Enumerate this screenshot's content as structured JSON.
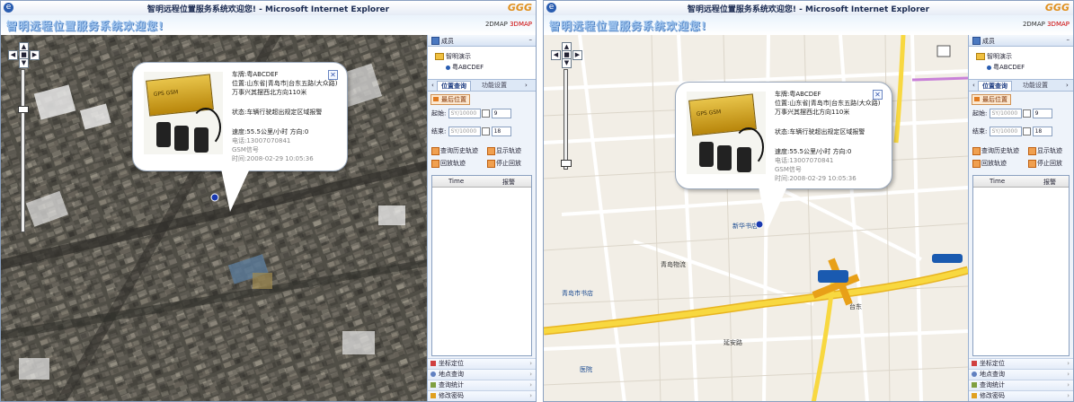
{
  "window": {
    "title": "智明远程位置服务系统欢迎您! - Microsoft Internet Explorer",
    "logo_text": "GGG"
  },
  "header": {
    "welcome": "智明远程位置服务系统欢迎您!",
    "map_2d": "2DMAP",
    "map_3d": "3DMAP"
  },
  "panel": {
    "section_title": "成员",
    "tree_group": "智明演示",
    "tree_vehicle": "粤ABCDEF",
    "tab_position_query": "位置查询",
    "tab_function_settings": "功能设置",
    "last_position": "最后位置",
    "start_label": "起始:",
    "end_label": "结束:",
    "date_placeholder": "SY/10000",
    "start_hour": "9",
    "end_hour": "18",
    "btn_query_history": "查询历史轨迹",
    "btn_show_track": "显示轨迹",
    "btn_replay_track": "回放轨迹",
    "btn_stop_replay": "停止回放",
    "col_time": "Time",
    "col_alarm": "报警",
    "bottom_menu": [
      "坐标定位",
      "地点查询",
      "查询统计",
      "修改密码"
    ]
  },
  "popup": {
    "plate": "车牌:粤ABCDEF",
    "location_1": "位置:山东省|青岛市|台东五路(大众路)",
    "location_2": "万事兴其摆西北方向110米",
    "status": "状态:车辆行驶超出规定区域报警",
    "speed": "速度:55.5公里/小时 方向:0",
    "phone": "电话:13007070841",
    "signal": "GSM信号",
    "time": "时间:2008-02-29 10:05:36",
    "device_brand": "GPS GSM"
  },
  "map2_labels": {
    "road_1": "延安路",
    "road_2": "台东",
    "poi_1": "青岛市书店",
    "poi_2": "新华书店",
    "poi_3": "青岛物流",
    "poi_4": "医院"
  },
  "colors": {
    "accent": "#2a5db0",
    "road_yellow": "#f8d840",
    "road_orange": "#e8a018",
    "map_bg": "#f2eee6"
  }
}
